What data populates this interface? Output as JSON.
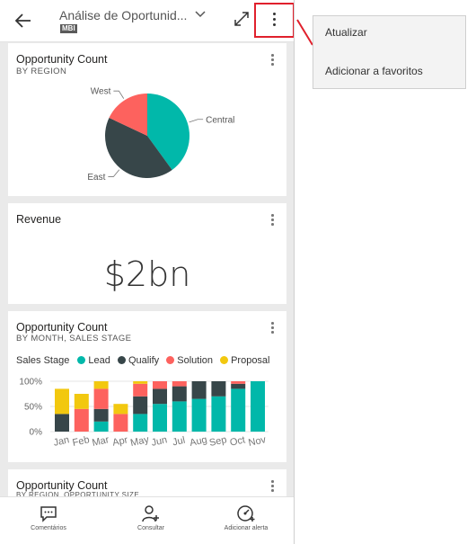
{
  "header": {
    "title": "Análise de Oportunid...",
    "badge": "MBI"
  },
  "menu": {
    "items": [
      {
        "label": "Atualizar"
      },
      {
        "label": "Adicionar a favoritos"
      }
    ]
  },
  "tiles": [
    {
      "title": "Opportunity Count",
      "subtitle": "BY REGION",
      "chart_data": {
        "type": "pie",
        "categories": [
          "Central",
          "East",
          "West"
        ],
        "values": [
          40,
          42,
          18
        ],
        "colors": [
          "#01b8aa",
          "#374649",
          "#fd625e"
        ]
      }
    },
    {
      "title": "Revenue",
      "value": "$2bn"
    },
    {
      "title": "Opportunity Count",
      "subtitle": "BY MONTH, SALES STAGE",
      "legend_title": "Sales Stage",
      "chart_data": {
        "type": "bar",
        "stacked": "100%",
        "categories": [
          "Jan",
          "Feb",
          "Mar",
          "Apr",
          "May",
          "Jun",
          "Jul",
          "Aug",
          "Sep",
          "Oct",
          "Nov"
        ],
        "ytick_labels": [
          "100%",
          "50%",
          "0%"
        ],
        "ylim": [
          0,
          100
        ],
        "series": [
          {
            "name": "Lead",
            "color": "#01b8aa",
            "values": [
              0,
              0,
              20,
              0,
              35,
              55,
              60,
              65,
              70,
              85,
              100
            ]
          },
          {
            "name": "Qualify",
            "color": "#374649",
            "values": [
              35,
              0,
              25,
              0,
              35,
              30,
              30,
              35,
              30,
              10,
              0
            ]
          },
          {
            "name": "Solution",
            "color": "#fd625e",
            "values": [
              0,
              45,
              40,
              35,
              25,
              15,
              10,
              0,
              0,
              5,
              0
            ]
          },
          {
            "name": "Proposal",
            "color": "#f2c80f",
            "values": [
              50,
              30,
              15,
              20,
              5,
              0,
              0,
              0,
              0,
              0,
              0
            ]
          }
        ]
      }
    },
    {
      "title": "Opportunity Count",
      "subtitle": "BY REGION, OPPORTUNITY SIZE"
    }
  ],
  "bottom_nav": [
    {
      "label": "Comentários",
      "icon": "comment-icon"
    },
    {
      "label": "Consultar",
      "icon": "person-add-icon"
    },
    {
      "label": "Adicionar alerta",
      "icon": "alert-gauge-icon"
    }
  ],
  "colors": {
    "highlight": "#e0202c",
    "accent": "#01b8aa"
  }
}
